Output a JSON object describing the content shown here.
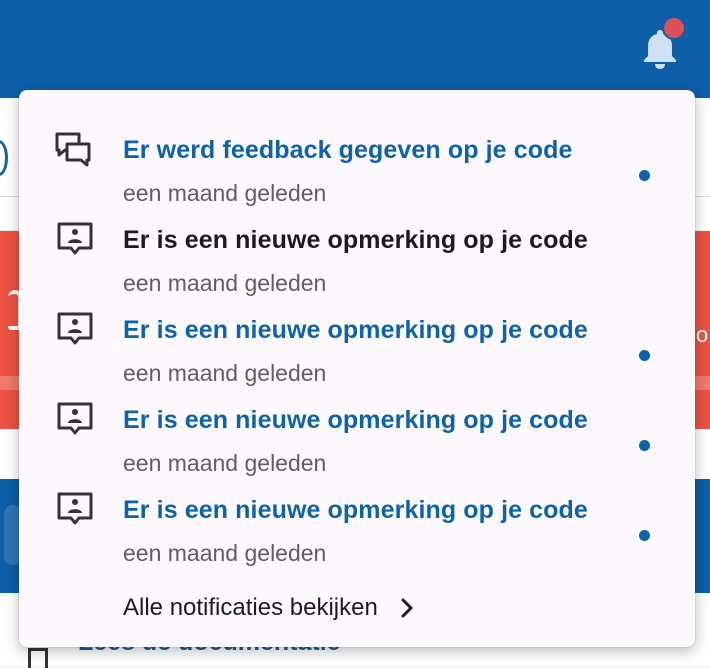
{
  "header": {
    "bell_icon": "bell-icon",
    "bell_badge_color": "#dc5057",
    "background_color": "#0d5fa8"
  },
  "background": {
    "bottom_link": "Lees de documentatie",
    "red_panel_color": "#ec5142"
  },
  "notifications": {
    "items": [
      {
        "title": "Er werd feedback gegeven op je code",
        "time": "een maand geleden",
        "icon": "feedback-icon",
        "unread": true
      },
      {
        "title": "Er is een nieuwe opmerking op je code",
        "time": "een maand geleden",
        "icon": "comment-icon",
        "unread": false
      },
      {
        "title": "Er is een nieuwe opmerking op je code",
        "time": "een maand geleden",
        "icon": "comment-icon",
        "unread": true
      },
      {
        "title": "Er is een nieuwe opmerking op je code",
        "time": "een maand geleden",
        "icon": "comment-icon",
        "unread": true
      },
      {
        "title": "Er is een nieuwe opmerking op je code",
        "time": "een maand geleden",
        "icon": "comment-icon",
        "unread": true
      }
    ],
    "view_all_label": "Alle notificaties bekijken",
    "unread_color": "#0d63a8"
  }
}
